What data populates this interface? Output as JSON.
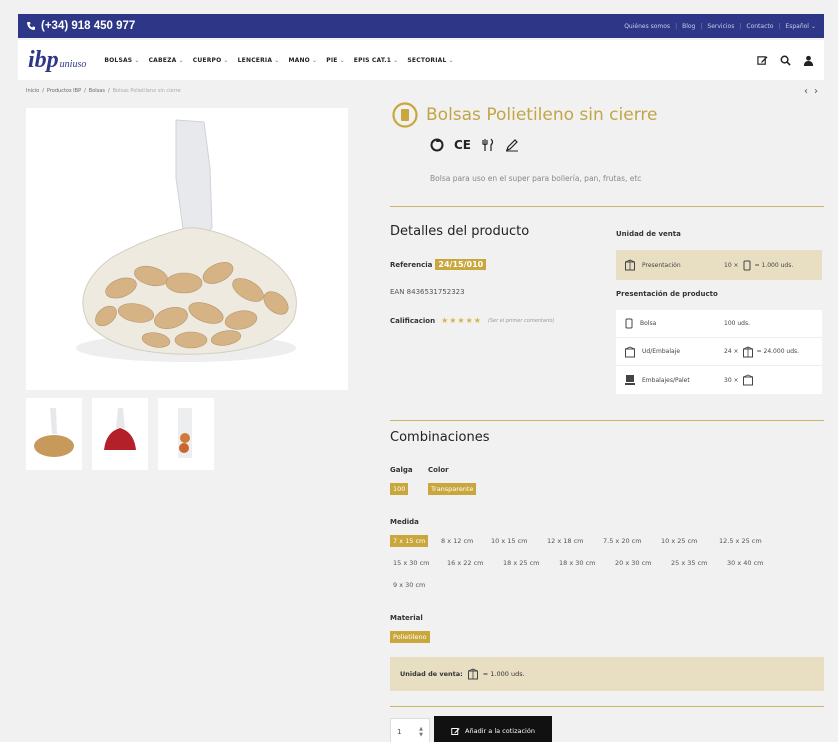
{
  "topbar": {
    "phone": "(+34) 918 450 977",
    "links": [
      "Quiénes somos",
      "Blog",
      "Servicios",
      "Contacto",
      "Español"
    ]
  },
  "header": {
    "logo_main": "ibp",
    "logo_sub": "uniuso",
    "nav": [
      "BOLSAS",
      "CABEZA",
      "CUERPO",
      "LENCERIA",
      "MANO",
      "PIE",
      "EPIS CAT.1",
      "SECTORIAL"
    ]
  },
  "breadcrumbs": [
    "Inicio",
    "Productos IBP",
    "Bolsas",
    "Bolsas Polietileno sin cierre"
  ],
  "product": {
    "title": "Bolsas Polietileno sin cierre",
    "cert_ce": "CE",
    "description": "Bolsa para uso en el super para bollería, pan, frutas, etc"
  },
  "details": {
    "title": "Detalles del producto",
    "ref_label": "Referencia",
    "ref_value": "24/15/010",
    "ean": "EAN 8436531752323",
    "rating_label": "Calificacion",
    "stars": "★★★★★",
    "first_comment": "(Ser el primer comentario)"
  },
  "sales_unit": {
    "header": "Unidad de venta",
    "label": "Presentación",
    "qty": "10 ×",
    "total": "= 1.000 uds."
  },
  "presentation": {
    "header": "Presentación de producto",
    "rows": [
      {
        "label": "Bolsa",
        "value": "100 uds.",
        "prefix": "",
        "suffix": ""
      },
      {
        "label": "Ud/Embalaje",
        "value": "",
        "prefix": "24 ×",
        "suffix": "= 24.000 uds."
      },
      {
        "label": "Embalajes/Palet",
        "value": "",
        "prefix": "30 ×",
        "suffix": ""
      }
    ]
  },
  "combinations": {
    "title": "Combinaciones",
    "galga_label": "Galga",
    "galga": [
      "100"
    ],
    "color_label": "Color",
    "color": [
      "Transparente"
    ],
    "medida_label": "Medida",
    "medida": [
      "7 x 15 cm",
      "8 x 12 cm",
      "10 x 15 cm",
      "12 x 18 cm",
      "7.5 x 20 cm",
      "10 x 25 cm",
      "12.5 x 25 cm",
      "15 x 30 cm",
      "16 x 22 cm",
      "18 x 25 cm",
      "18 x 30 cm",
      "20 x 30 cm",
      "25 x 35 cm",
      "30 x 40 cm",
      "9 x 30 cm"
    ],
    "material_label": "Material",
    "material": [
      "Polietileno"
    ]
  },
  "unit_box": {
    "label": "Unidad de venta:",
    "value": "= 1.000 uds."
  },
  "cart": {
    "qty": "1",
    "button": "Añadir a la cotización"
  },
  "colors": {
    "brand": "#2e3687",
    "gold": "#c9a73c",
    "beige": "#e8dfc2"
  }
}
